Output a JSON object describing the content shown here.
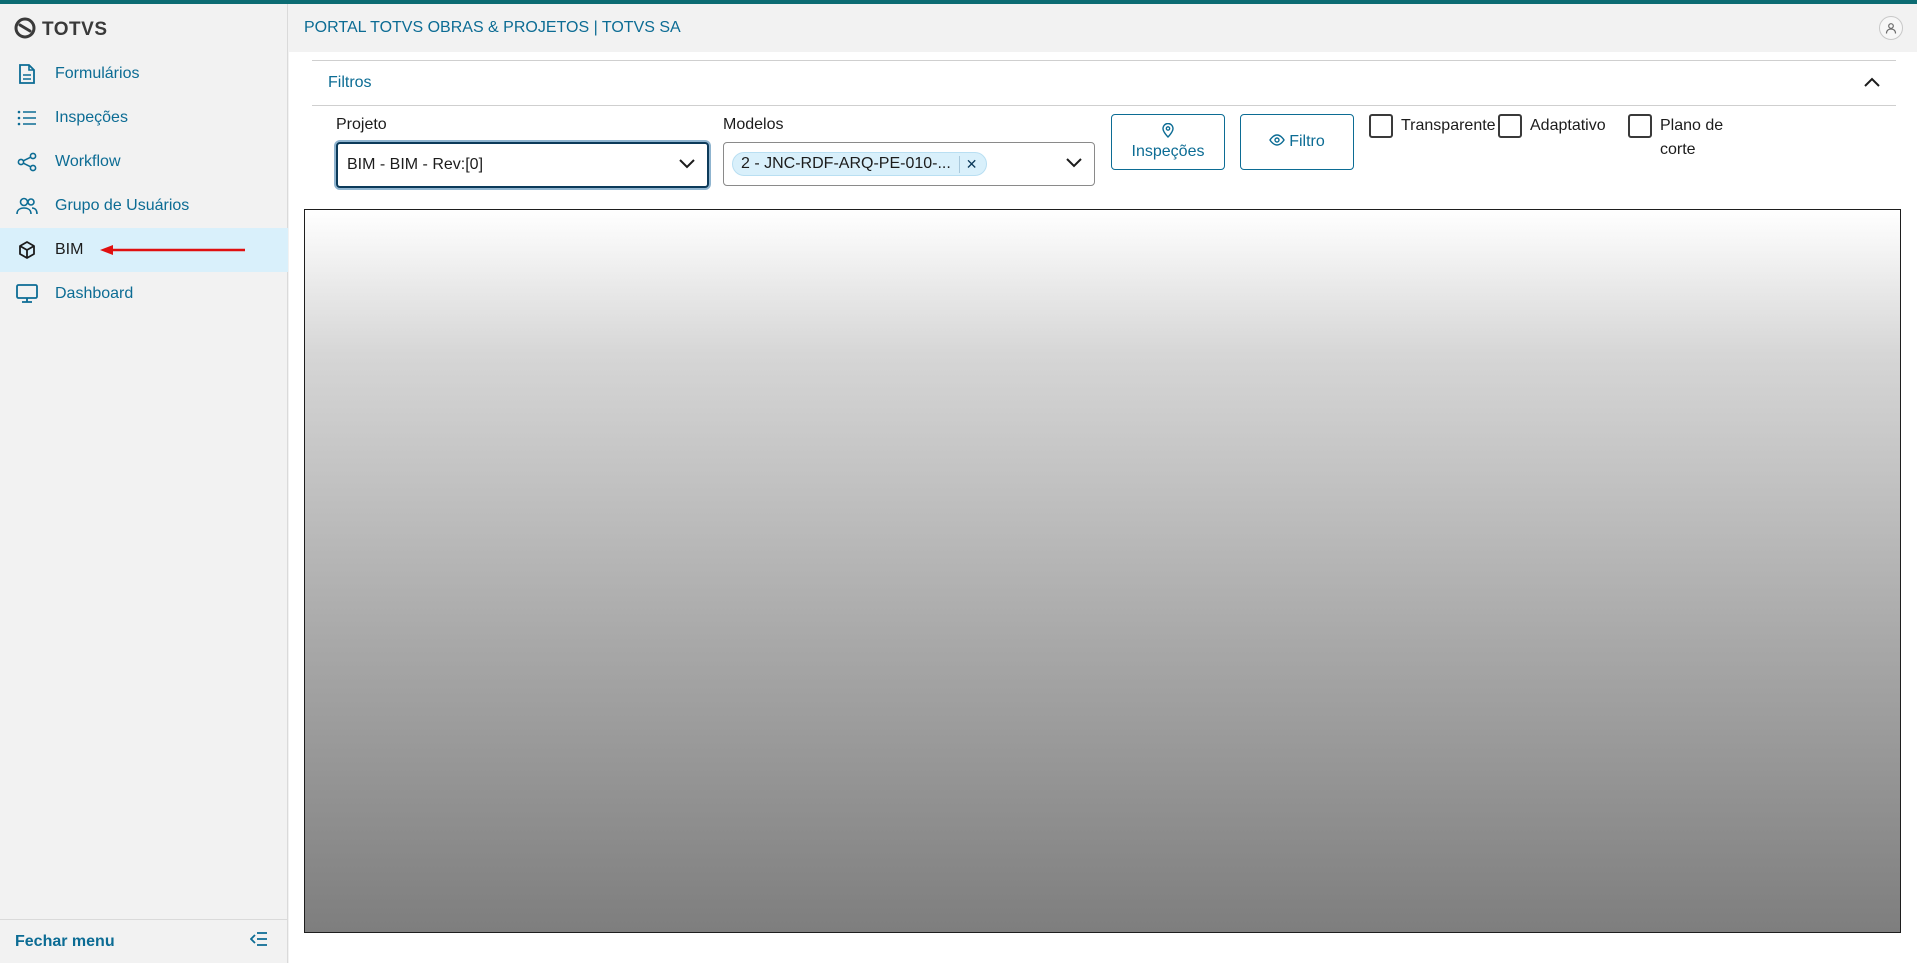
{
  "app": {
    "logo_text": "TOTVS",
    "header_title": "PORTAL TOTVS OBRAS & PROJETOS | TOTVS SA"
  },
  "sidebar": {
    "items": [
      {
        "label": "Formulários",
        "icon": "document-icon"
      },
      {
        "label": "Inspeções",
        "icon": "list-icon"
      },
      {
        "label": "Workflow",
        "icon": "share-nodes-icon"
      },
      {
        "label": "Grupo de Usuários",
        "icon": "users-icon"
      },
      {
        "label": "BIM",
        "icon": "cube-icon",
        "active": true
      },
      {
        "label": "Dashboard",
        "icon": "monitor-icon"
      }
    ],
    "close_menu_label": "Fechar menu"
  },
  "filters": {
    "section_label": "Filtros",
    "projeto_label": "Projeto",
    "projeto_value": "BIM - BIM - Rev:[0]",
    "modelos_label": "Modelos",
    "modelos_chip": "2 - JNC-RDF-ARQ-PE-010-...",
    "inspecoes_button": "Inspeções",
    "filtro_button": "Filtro",
    "checkbox_transparente": "Transparente",
    "checkbox_adaptativo": "Adaptativo",
    "checkbox_plano_line1": "Plano de",
    "checkbox_plano_line2": "corte"
  },
  "colors": {
    "accent": "#0c6c94",
    "top_line": "#0c6c73",
    "active_bg": "#d9f0fb",
    "annotation_arrow": "#e01010"
  }
}
